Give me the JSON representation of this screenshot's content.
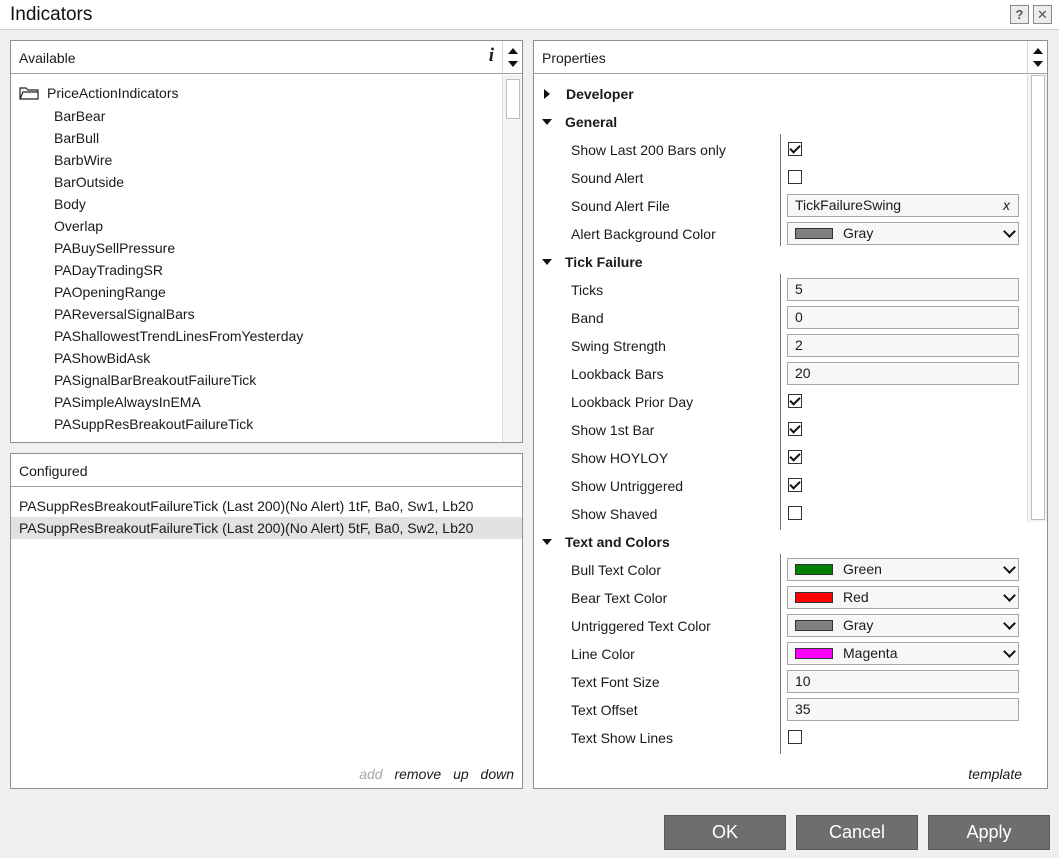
{
  "window": {
    "title": "Indicators",
    "help_label": "?",
    "close_label": "✕"
  },
  "available": {
    "title": "Available",
    "info_label": "i",
    "folder": "PriceActionIndicators",
    "items": [
      "BarBear",
      "BarBull",
      "BarbWire",
      "BarOutside",
      "Body",
      "Overlap",
      "PABuySellPressure",
      "PADayTradingSR",
      "PAOpeningRange",
      "PAReversalSignalBars",
      "PAShallowestTrendLinesFromYesterday",
      "PAShowBidAsk",
      "PASignalBarBreakoutFailureTick",
      "PASimpleAlwaysInEMA",
      "PASuppResBreakoutFailureTick"
    ]
  },
  "configured": {
    "title": "Configured",
    "items": [
      "PASuppResBreakoutFailureTick (Last 200)(No Alert) 1tF,  Ba0,  Sw1,  Lb20",
      "PASuppResBreakoutFailureTick (Last 200)(No Alert) 5tF,  Ba0,  Sw2,  Lb20"
    ],
    "selected_index": 1,
    "actions": {
      "add": "add",
      "remove": "remove",
      "up": "up",
      "down": "down"
    }
  },
  "properties": {
    "title": "Properties",
    "template_link": "template",
    "categories": {
      "developer": "Developer",
      "general": "General",
      "tick_failure": "Tick Failure",
      "text_colors": "Text and Colors"
    },
    "general": {
      "show_last_200": {
        "label": "Show Last 200 Bars only",
        "checked": true
      },
      "sound_alert": {
        "label": "Sound Alert",
        "checked": false
      },
      "sound_alert_file": {
        "label": "Sound Alert File",
        "value": "TickFailureSwing",
        "clear": "x"
      },
      "alert_bg_color": {
        "label": "Alert Background Color",
        "value": "Gray",
        "swatch": "#808080"
      }
    },
    "tick": {
      "ticks": {
        "label": "Ticks",
        "value": "5"
      },
      "band": {
        "label": "Band",
        "value": "0"
      },
      "swing_strength": {
        "label": "Swing Strength",
        "value": "2"
      },
      "lookback_bars": {
        "label": "Lookback Bars",
        "value": "20"
      },
      "lookback_prior_day": {
        "label": "Lookback Prior Day",
        "checked": true
      },
      "show_1st_bar": {
        "label": "Show 1st Bar",
        "checked": true
      },
      "show_hoyloy": {
        "label": "Show HOYLOY",
        "checked": true
      },
      "show_untriggered": {
        "label": "Show Untriggered",
        "checked": true
      },
      "show_shaved": {
        "label": "Show Shaved",
        "checked": false
      }
    },
    "text_colors": {
      "bull_text_color": {
        "label": "Bull Text Color",
        "value": "Green",
        "swatch": "#008000"
      },
      "bear_text_color": {
        "label": "Bear Text Color",
        "value": "Red",
        "swatch": "#ff0000"
      },
      "untriggered_text_color": {
        "label": "Untriggered Text Color",
        "value": "Gray",
        "swatch": "#808080"
      },
      "line_color": {
        "label": "Line Color",
        "value": "Magenta",
        "swatch": "#ff00ff"
      },
      "text_font_size": {
        "label": "Text Font Size",
        "value": "10"
      },
      "text_offset": {
        "label": "Text Offset",
        "value": "35"
      },
      "text_show_lines": {
        "label": "Text Show Lines",
        "checked": false
      }
    }
  },
  "buttons": {
    "ok": "OK",
    "cancel": "Cancel",
    "apply": "Apply"
  }
}
